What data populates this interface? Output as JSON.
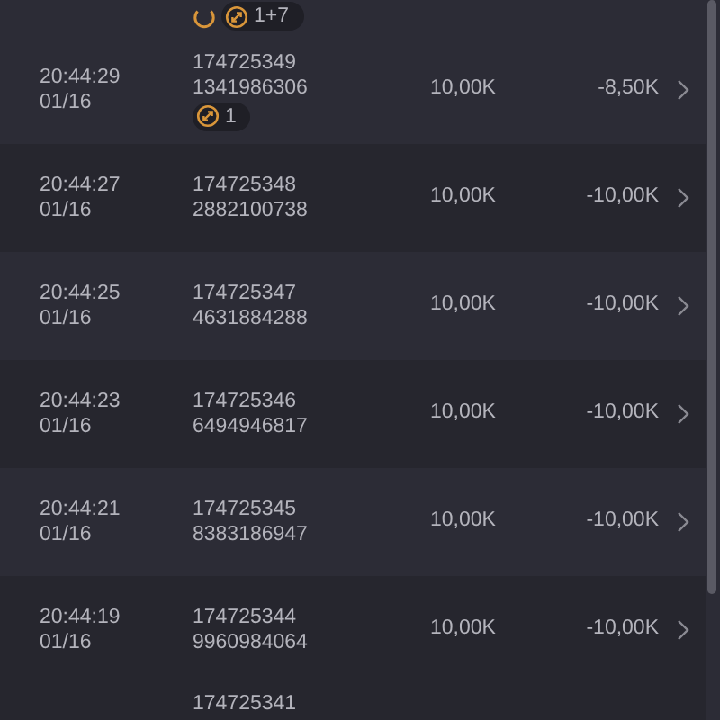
{
  "rows": [
    {
      "badges": [
        {
          "kind": "spinner"
        },
        {
          "kind": "swap",
          "count": "1+7"
        }
      ]
    },
    {
      "time": "20:44:29",
      "date": "01/16",
      "order_id": "174725349",
      "ref": "1341986306",
      "badges": [
        {
          "kind": "swap",
          "count": "1"
        }
      ],
      "amount": "10,00K",
      "pnl": "-8,50K"
    },
    {
      "time": "20:44:27",
      "date": "01/16",
      "order_id": "174725348",
      "ref": "2882100738",
      "amount": "10,00K",
      "pnl": "-10,00K"
    },
    {
      "time": "20:44:25",
      "date": "01/16",
      "order_id": "174725347",
      "ref": "4631884288",
      "amount": "10,00K",
      "pnl": "-10,00K"
    },
    {
      "time": "20:44:23",
      "date": "01/16",
      "order_id": "174725346",
      "ref": "6494946817",
      "amount": "10,00K",
      "pnl": "-10,00K"
    },
    {
      "time": "20:44:21",
      "date": "01/16",
      "order_id": "174725345",
      "ref": "8383186947",
      "amount": "10,00K",
      "pnl": "-10,00K"
    },
    {
      "time": "20:44:19",
      "date": "01/16",
      "order_id": "174725344",
      "ref": "9960984064",
      "amount": "10,00K",
      "pnl": "-10,00K"
    },
    {
      "order_id": "174725341"
    }
  ]
}
